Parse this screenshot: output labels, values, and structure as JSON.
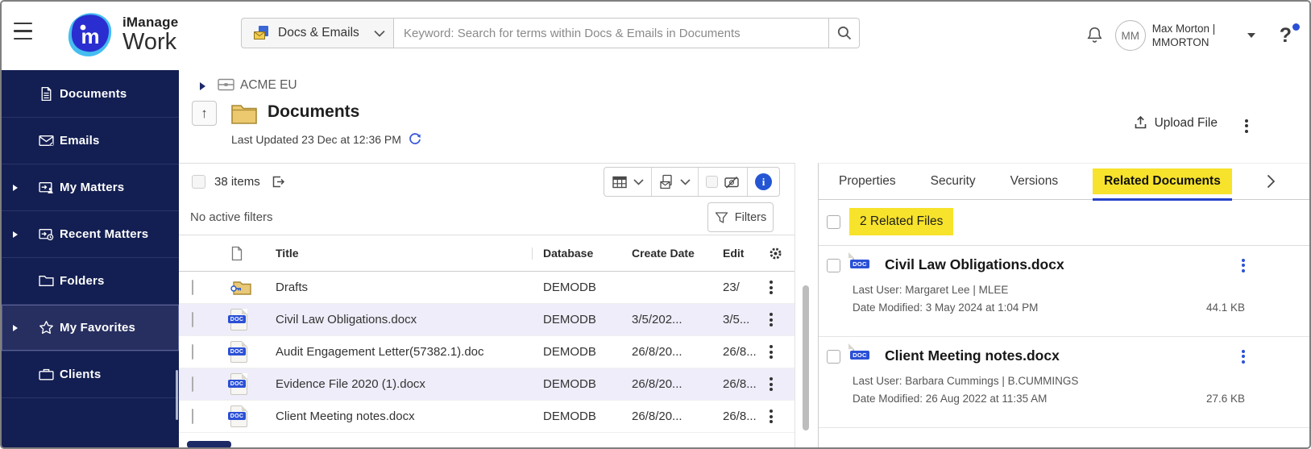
{
  "topbar": {
    "logo_line1": "iManage",
    "logo_line2": "Work",
    "scope_label": "Docs & Emails",
    "search_placeholder": "Keyword: Search for terms within Docs & Emails in Documents",
    "avatar_initials": "MM",
    "user_line1": "Max Morton |",
    "user_line2": "MMORTON",
    "help_glyph": "?"
  },
  "sidebar": {
    "items": [
      {
        "label": "Documents"
      },
      {
        "label": "Emails"
      },
      {
        "label": "My Matters"
      },
      {
        "label": "Recent Matters"
      },
      {
        "label": "Folders"
      },
      {
        "label": "My Favorites"
      },
      {
        "label": "Clients"
      }
    ]
  },
  "breadcrumb": {
    "workspace": "ACME EU"
  },
  "header": {
    "title": "Documents",
    "last_updated": "Last Updated 23 Dec at 12:36 PM",
    "upload_label": "Upload File"
  },
  "toolbar": {
    "items_count": "38 items",
    "no_filters_text": "No active filters",
    "filters_label": "Filters"
  },
  "table": {
    "columns": {
      "title": "Title",
      "database": "Database",
      "create_date": "Create Date",
      "edit_date": "Edit"
    },
    "rows": [
      {
        "title": "Drafts",
        "database": "DEMODB",
        "create_date": "",
        "edit_date": "23/"
      },
      {
        "title": "Civil Law Obligations.docx",
        "database": "DEMODB",
        "create_date": "3/5/202...",
        "edit_date": "3/5..."
      },
      {
        "title": "Audit Engagement Letter(57382.1).doc",
        "database": "DEMODB",
        "create_date": "26/8/20...",
        "edit_date": "26/8..."
      },
      {
        "title": "Evidence File 2020 (1).docx",
        "database": "DEMODB",
        "create_date": "26/8/20...",
        "edit_date": "26/8..."
      },
      {
        "title": "Client Meeting notes.docx",
        "database": "DEMODB",
        "create_date": "26/8/20...",
        "edit_date": "26/8..."
      }
    ]
  },
  "panel": {
    "tabs": [
      {
        "label": "Properties"
      },
      {
        "label": "Security"
      },
      {
        "label": "Versions"
      },
      {
        "label": "Related Documents"
      }
    ],
    "related_count": "2 Related Files",
    "files": [
      {
        "title": "Civil Law Obligations.docx",
        "last_user": "Last User: Margaret Lee | MLEE",
        "date_modified": "Date Modified: 3 May 2024 at 1:04 PM",
        "size": "44.1 KB"
      },
      {
        "title": "Client Meeting notes.docx",
        "last_user": "Last User: Barbara Cummings | B.CUMMINGS",
        "date_modified": "Date Modified: 26 Aug 2022 at 11:35 AM",
        "size": "27.6 KB"
      }
    ]
  },
  "icons": {
    "doc_badge": "DOC"
  },
  "colors": {
    "sidebar_navy": "#131f52",
    "highlight_yellow": "#f7e32b",
    "accent_blue": "#2b50d6",
    "row_stripe": "#eeedf9"
  }
}
